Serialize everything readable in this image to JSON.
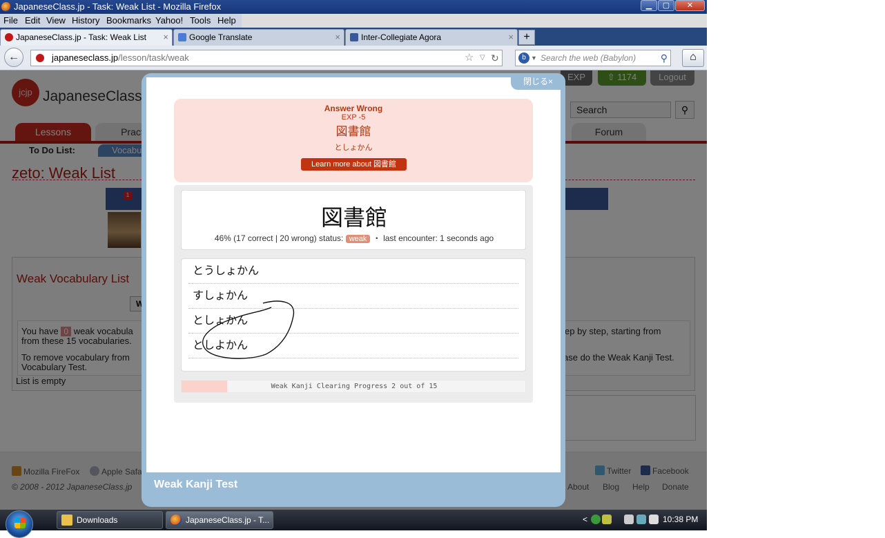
{
  "window": {
    "title": "JapaneseClass.jp - Task: Weak List - Mozilla Firefox",
    "min_icon": "minimize-icon",
    "max_icon": "maximize-icon",
    "close_label": "✕"
  },
  "menu": [
    "File",
    "Edit",
    "View",
    "History",
    "Bookmarks",
    "Yahoo!",
    "Tools",
    "Help"
  ],
  "tabs": [
    {
      "label": "JapaneseClass.jp - Task: Weak List",
      "icon": "japaneseclass-favicon",
      "close": "×"
    },
    {
      "label": "Google Translate",
      "icon": "google-translate-icon",
      "close": "×"
    },
    {
      "label": "Inter-Collegiate Agora",
      "icon": "facebook-icon",
      "close": "×"
    }
  ],
  "new_tab_label": "+",
  "nav": {
    "url_domain": "japaneseclass.jp",
    "url_path": "/lesson/task/weak",
    "search_placeholder": "Search the web (Babylon)"
  },
  "site": {
    "logo_mark": "jcjp",
    "logo_text_main": "JapaneseClass",
    "logo_text_accent": ".",
    "exp_text": "EXP",
    "gold_text": "1174",
    "logout_label": "Logout",
    "search_label": "Search",
    "nav_lessons": "Lessons",
    "nav_practice": "Practi",
    "nav_forum": "Forum",
    "todo_label": "To Do List:",
    "vocab_tab": "Vocabu",
    "page_title": "zeto: Weak List",
    "fb_notification": "1",
    "weak_vocab_title": "Weak Vocabulary List",
    "weak_btn": "W",
    "info_line1_a": "You have",
    "info_zero": "0",
    "info_line1_b": "weak vocabula",
    "info_line1_right": "ep by step, starting from",
    "info_line2": "from these 15 vocabularies.",
    "info_line3": "To remove vocabulary from",
    "info_line3_right": "ase do the Weak Kanji Test.",
    "info_line4": "Vocabulary Test.",
    "list_empty": "List is empty"
  },
  "footer": {
    "firefox": "Mozilla FireFox",
    "safari": "Apple Safa",
    "twitter": "Twitter",
    "facebook": "Facebook",
    "copyright": "© 2008 - 2012 JapaneseClass.jp",
    "links": [
      "About",
      "Blog",
      "Help",
      "Donate"
    ]
  },
  "modal": {
    "close_label": "閉じる×",
    "footer_title": "Weak Kanji Test",
    "result": {
      "title": "Answer Wrong",
      "exp": "EXP -5",
      "kanji": "図書館",
      "reading": "としょかん",
      "learn_more": "Learn more about 図書館"
    },
    "question": {
      "kanji": "図書館",
      "stats": "46% (17 correct | 20 wrong) status:",
      "status": "weak",
      "last": "・ last encounter: 1 seconds ago"
    },
    "answers": [
      "とうしょかん",
      "すしょかん",
      "としょかん",
      "としよかん"
    ],
    "progress": {
      "text": "Weak Kanji Clearing Progress 2 out of 15",
      "done": 2,
      "total": 15,
      "fill_color": "#fcd2cc"
    }
  },
  "taskbar": {
    "buttons": [
      {
        "label": "Downloads",
        "icon": "folder-icon"
      },
      {
        "label": "JapaneseClass.jp - T...",
        "icon": "firefox-icon"
      }
    ],
    "clock": "10:38 PM",
    "tray_expand": "<"
  },
  "colors": {
    "accent_red": "#b01b12",
    "modal_blue": "#9bbcd7",
    "result_bg": "#fbe0dc",
    "learn_btn": "#c0340f"
  }
}
